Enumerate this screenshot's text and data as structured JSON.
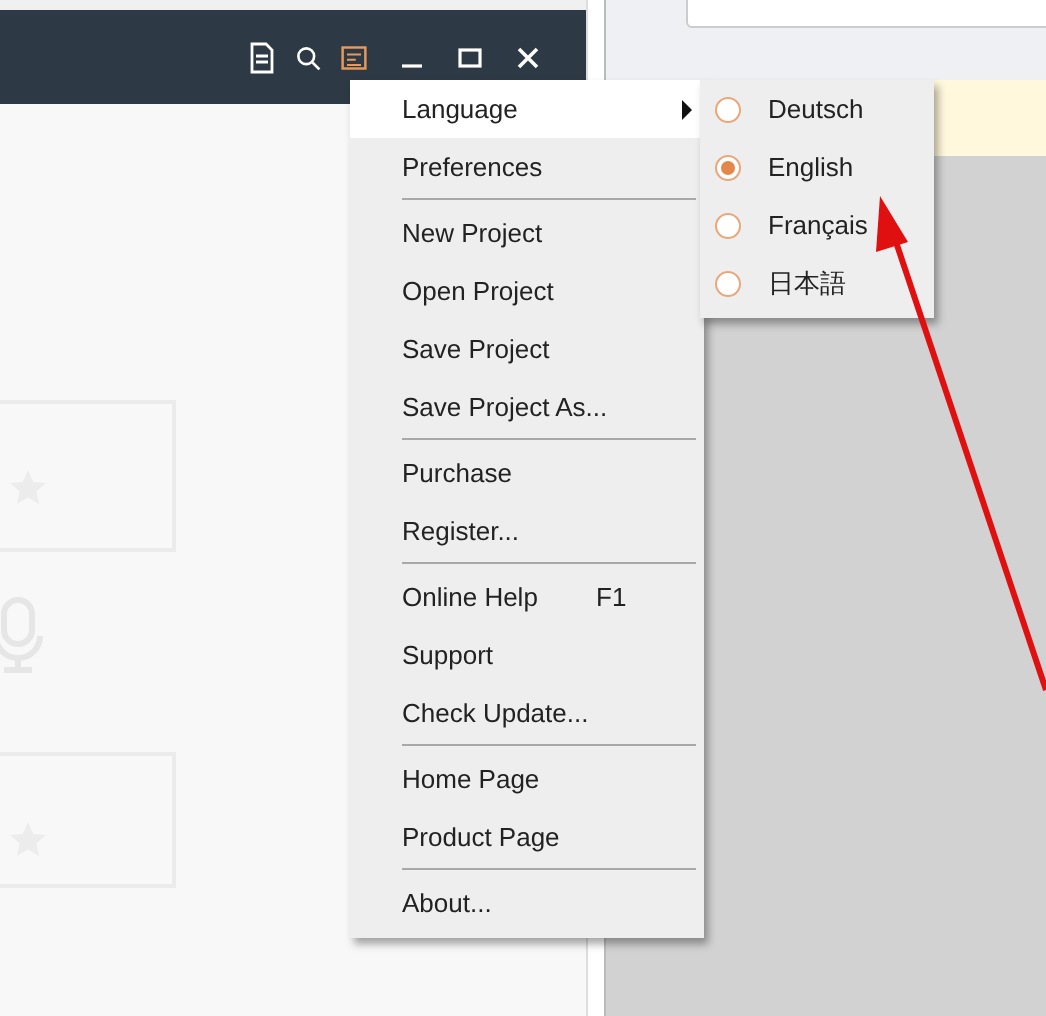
{
  "menu": {
    "items": [
      {
        "kind": "submenu",
        "label": "Language",
        "highlighted": true
      },
      {
        "kind": "item",
        "label": "Preferences",
        "highlighted": false
      },
      {
        "kind": "separator"
      },
      {
        "kind": "item",
        "label": "New Project",
        "highlighted": false
      },
      {
        "kind": "item",
        "label": "Open Project",
        "highlighted": false
      },
      {
        "kind": "item",
        "label": "Save Project",
        "highlighted": false
      },
      {
        "kind": "item",
        "label": "Save Project As...",
        "highlighted": false
      },
      {
        "kind": "separator"
      },
      {
        "kind": "item",
        "label": "Purchase",
        "highlighted": false
      },
      {
        "kind": "item",
        "label": "Register...",
        "highlighted": false
      },
      {
        "kind": "separator"
      },
      {
        "kind": "item",
        "label": "Online Help",
        "shortcut": "F1",
        "highlighted": false
      },
      {
        "kind": "item",
        "label": "Support",
        "highlighted": false
      },
      {
        "kind": "item",
        "label": "Check Update...",
        "highlighted": false
      },
      {
        "kind": "separator"
      },
      {
        "kind": "item",
        "label": "Home Page",
        "highlighted": false
      },
      {
        "kind": "item",
        "label": "Product Page",
        "highlighted": false
      },
      {
        "kind": "separator"
      },
      {
        "kind": "item",
        "label": "About...",
        "highlighted": false
      }
    ]
  },
  "language_menu": {
    "items": [
      {
        "label": "Deutsch",
        "selected": false
      },
      {
        "label": "English",
        "selected": true
      },
      {
        "label": "Français",
        "selected": false
      },
      {
        "label": "日本語",
        "selected": false
      }
    ]
  }
}
